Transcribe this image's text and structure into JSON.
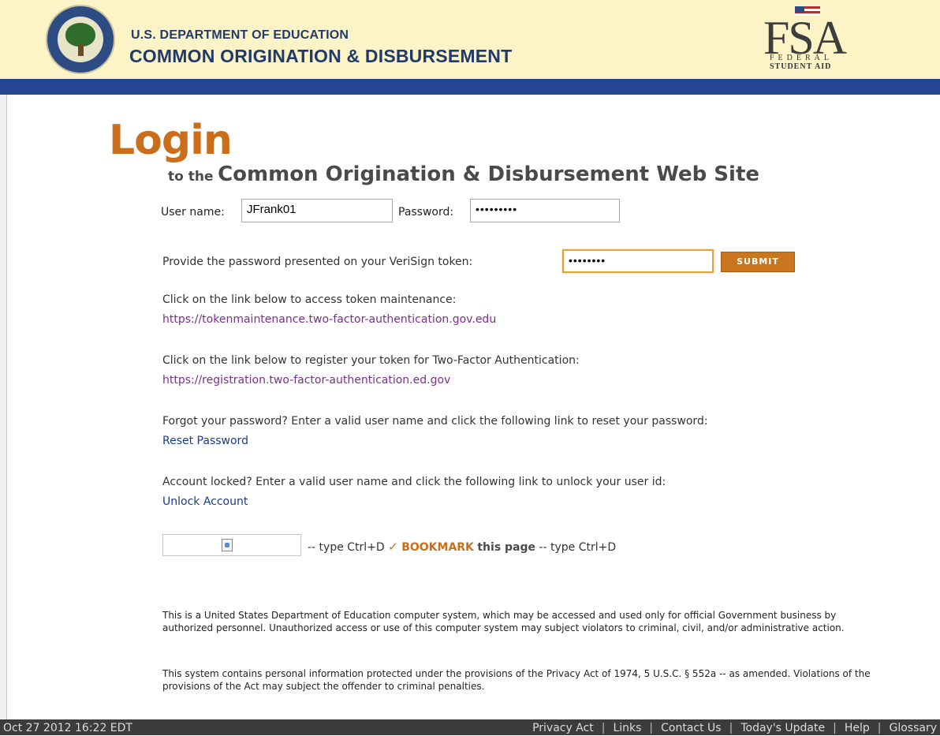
{
  "header": {
    "line1": "U.S. DEPARTMENT OF EDUCATION",
    "line2": "COMMON ORIGINATION & DISBURSEMENT",
    "fsa_letters": "FSA",
    "fsa_sub1": "FEDERAL",
    "fsa_sub2": "STUDENT AID"
  },
  "login": {
    "title": "Login",
    "subtitle_small": "to the",
    "subtitle_big": "Common Origination & Disbursement  Web Site"
  },
  "form": {
    "username_label": "User name:",
    "username_value": "JFrank01",
    "password_label": "Password:",
    "password_value": "•••••••••",
    "token_label": "Provide the password presented on your VeriSign token:",
    "token_value": "••••••••",
    "submit_label": "SUBMIT"
  },
  "links": {
    "maintenance_text": "Click on the link below to access token maintenance:",
    "maintenance_url": "https://tokenmaintenance.two-factor-authentication.gov.edu",
    "register_text": "Click on the link below to register your token for Two-Factor Authentication:",
    "register_url": "https://registration.two-factor-authentication.ed.gov",
    "forgot_text": "Forgot your password? Enter a valid user name and click the following link to reset your password:",
    "reset_label": "Reset Password",
    "locked_text": "Account locked? Enter a valid user name and click the following link to unlock your user id:",
    "unlock_label": "Unlock Account"
  },
  "bookmark": {
    "prefix": "-- type Ctrl+D",
    "check": "✓",
    "bookmark_word": "BOOKMARK",
    "this_page": "this page",
    "suffix": "-- type Ctrl+D"
  },
  "notices": {
    "p1": "This is a United States Department of Education computer system, which may be accessed and used only for official Government business by authorized personnel. Unauthorized access or use of this computer system may subject violators to criminal, civil, and/or administrative action.",
    "p2": "This system contains personal information protected under the provisions of the Privacy Act of 1974, 5 U.S.C. § 552a -- as amended. Violations of the provisions of the Act may subject the offender to criminal penalties."
  },
  "footer": {
    "date": "Oct 27 2012 16:22 EDT",
    "nav": [
      "Privacy Act",
      "Links",
      "Contact Us",
      "Today's Update",
      "Help",
      "Glossary"
    ],
    "separator": "|"
  },
  "colors": {
    "accent_orange": "#c96e1b",
    "navy": "#234791",
    "header_bg": "#fcf4c6"
  }
}
